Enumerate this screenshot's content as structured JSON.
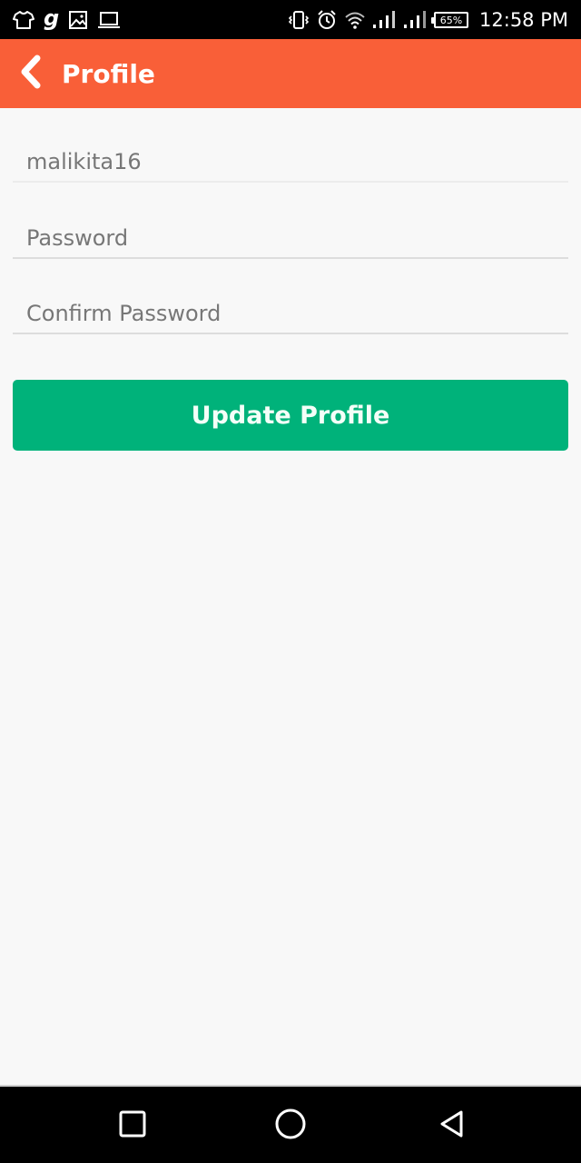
{
  "status_bar": {
    "left_icons": [
      "shirt-icon",
      "g-app-icon",
      "image-icon",
      "laptop-icon"
    ],
    "g_glyph": "g",
    "right_icons": [
      "vibrate-icon",
      "alarm-icon",
      "wifi-icon",
      "signal-sim1-icon",
      "signal-sim2-icon",
      "battery-icon"
    ],
    "battery": "65%",
    "time": "12:58 PM"
  },
  "app_bar": {
    "title": "Profile",
    "back_icon": "chevron-left-icon",
    "color": "#f95f38"
  },
  "form": {
    "username": {
      "value": "",
      "placeholder": "malikita16"
    },
    "password": {
      "value": "",
      "placeholder": "Password"
    },
    "confirm_password": {
      "value": "",
      "placeholder": "Confirm Password"
    },
    "submit_label": "Update Profile",
    "submit_color": "#00b27a"
  },
  "nav_bar": {
    "buttons": [
      "recents-square-icon",
      "home-circle-icon",
      "back-triangle-icon"
    ]
  }
}
